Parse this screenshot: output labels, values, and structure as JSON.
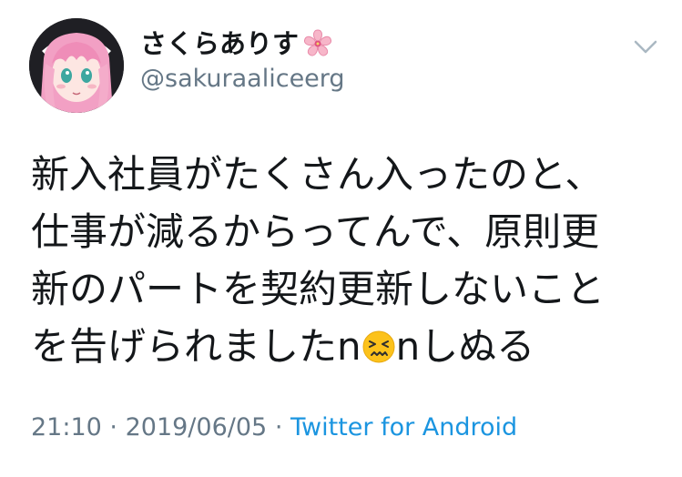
{
  "tweet": {
    "display_name": "さくらありす",
    "name_emoji": "cherry-blossom-icon",
    "handle": "@sakuraaliceerg",
    "text_lines": [
      "新入社員がたくさん入ったのと、",
      "仕事が減るからってんで、原則更",
      "新のパートを契約更新しないこと"
    ],
    "last_line_prefix": "を告げられましたn",
    "inline_emoji": "confounded-face-icon",
    "last_line_suffix": "nしぬる",
    "time": "21:10",
    "separator": "·",
    "date": "2019/06/05",
    "source": "Twitter for Android",
    "colors": {
      "text": "#14171a",
      "secondary": "#657786",
      "link": "#1b95e0"
    }
  }
}
